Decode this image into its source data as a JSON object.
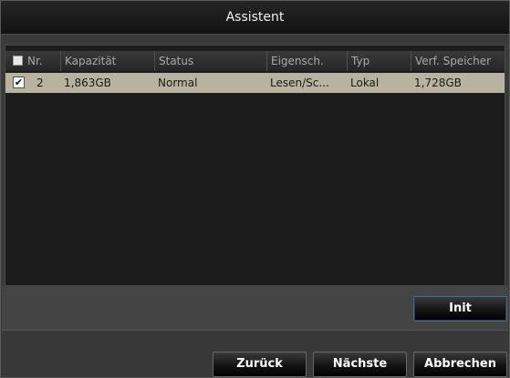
{
  "window": {
    "title": "Assistent"
  },
  "table": {
    "columns": [
      "Nr.",
      "Kapazität",
      "Status",
      "Eigensch.",
      "Typ",
      "Verf. Speicher"
    ],
    "rows": [
      {
        "checked": true,
        "nr": "2",
        "kapazitaet": "1,863GB",
        "status": "Normal",
        "eigenschaft": "Lesen/Sc...",
        "typ": "Lokal",
        "speicher": "1,728GB"
      }
    ]
  },
  "buttons": {
    "init": "Init",
    "back": "Zurück",
    "next": "Nächste",
    "cancel": "Abbrechen"
  },
  "icons": {
    "checkmark": "✔"
  }
}
